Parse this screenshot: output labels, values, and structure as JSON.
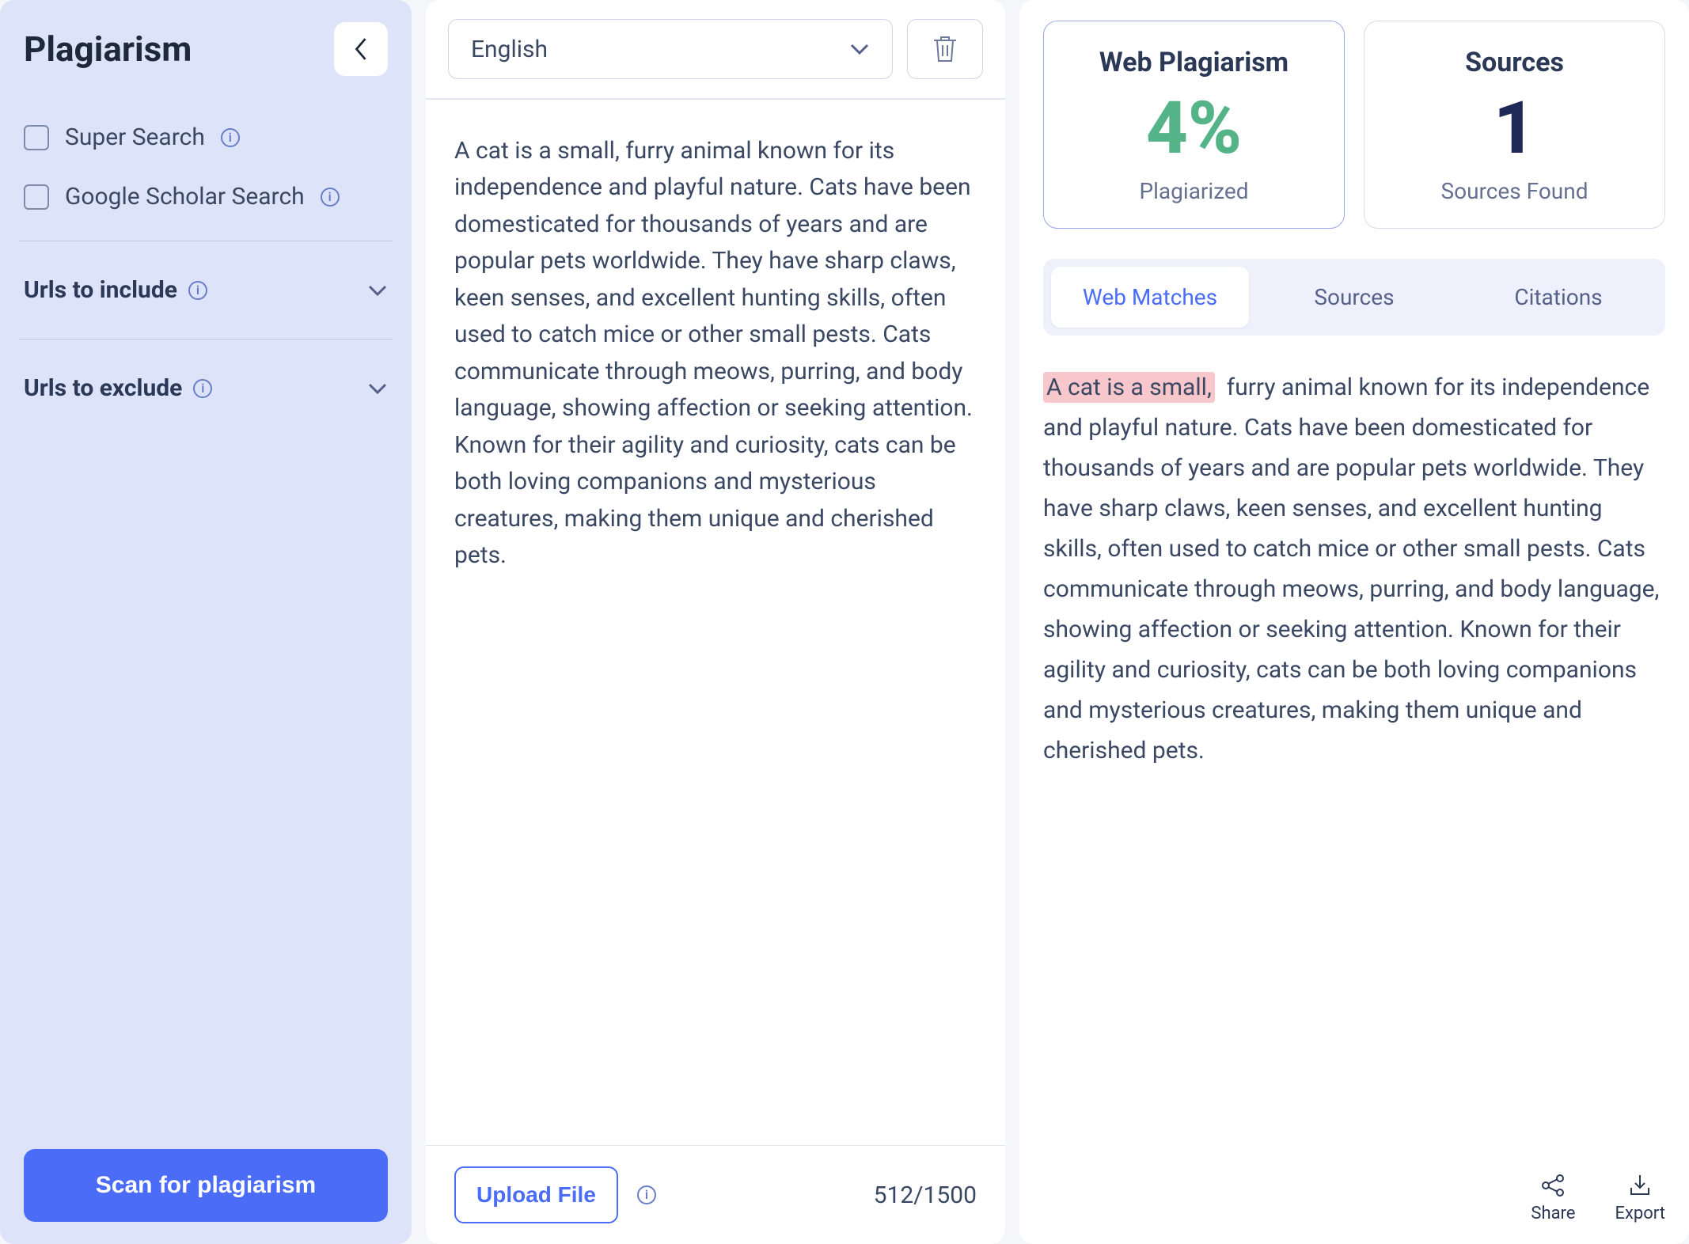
{
  "sidebar": {
    "title": "Plagiarism",
    "options": [
      {
        "label": "Super Search"
      },
      {
        "label": "Google Scholar Search"
      }
    ],
    "accordions": [
      {
        "label": "Urls to include"
      },
      {
        "label": "Urls to exclude"
      }
    ],
    "scan_label": "Scan for plagiarism"
  },
  "editor": {
    "language": "English",
    "text": "A cat is a small, furry animal known for its independence and playful nature. Cats have been domesticated for thousands of years and are popular pets worldwide. They have sharp claws, keen senses, and excellent hunting skills, often used to catch mice or other small pests. Cats communicate through meows, purring, and body language, showing affection or seeking attention. Known for their agility and curiosity, cats can be both loving companions and mysterious creatures, making them unique and cherished pets.",
    "upload_label": "Upload File",
    "char_count": "512/1500"
  },
  "results": {
    "cards": [
      {
        "title": "Web Plagiarism",
        "value": "4%",
        "sub": "Plagiarized"
      },
      {
        "title": "Sources",
        "value": "1",
        "sub": "Sources Found"
      }
    ],
    "tabs": [
      {
        "label": "Web Matches"
      },
      {
        "label": "Sources"
      },
      {
        "label": "Citations"
      }
    ],
    "highlight": "A cat is a small,",
    "rest": " furry animal known for its independence and playful nature. Cats have been domesticated for thousands of years and are popular pets worldwide. They have sharp claws, keen senses, and excellent hunting skills, often used to catch mice or other small pests. Cats communicate through meows, purring, and body language, showing affection or seeking attention. Known for their agility and curiosity, cats can be both loving companions and mysterious creatures, making them unique and cherished pets.",
    "actions": {
      "share": "Share",
      "export": "Export"
    }
  }
}
